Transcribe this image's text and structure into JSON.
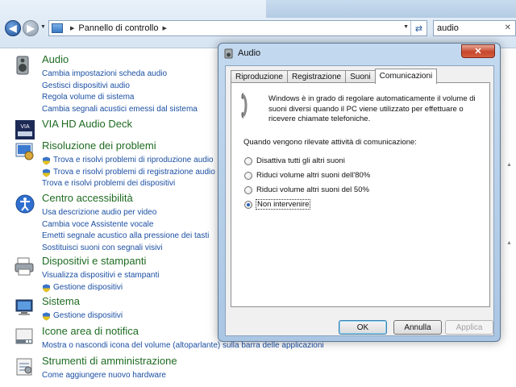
{
  "explorer": {
    "address_label": "Pannello di controllo",
    "search_value": "audio",
    "colors": {
      "category_title": "#1e6b21",
      "link": "#1b4fa3"
    }
  },
  "categories": [
    {
      "title": "Audio",
      "icon": "speaker-icon",
      "links": [
        {
          "label": "Cambia impostazioni scheda audio",
          "shield": false
        },
        {
          "label": "Gestisci dispositivi audio",
          "shield": false
        },
        {
          "label": "Regola volume di sistema",
          "shield": false
        },
        {
          "label": "Cambia segnali acustici emessi dal sistema",
          "shield": false
        }
      ]
    },
    {
      "title": "VIA HD Audio Deck",
      "icon": "via-deck-icon",
      "links": []
    },
    {
      "title": "Risoluzione dei problemi",
      "icon": "troubleshoot-icon",
      "links": [
        {
          "label": "Trova e risolvi problemi di riproduzione audio",
          "shield": true
        },
        {
          "label": "Trova e risolvi problemi di registrazione audio",
          "shield": true
        },
        {
          "label": "Trova e risolvi problemi dei dispositivi",
          "shield": false
        }
      ]
    },
    {
      "title": "Centro accessibilità",
      "icon": "accessibility-icon",
      "links": [
        {
          "label": "Usa descrizione audio per video",
          "shield": false
        },
        {
          "label": "Cambia voce Assistente vocale",
          "shield": false
        },
        {
          "label": "Emetti segnale acustico alla pressione dei tasti",
          "shield": false
        },
        {
          "label": "Sostituisci suoni con segnali visivi",
          "shield": false
        }
      ]
    },
    {
      "title": "Dispositivi e stampanti",
      "icon": "printer-icon",
      "links": [
        {
          "label": "Visualizza dispositivi e stampanti",
          "shield": false
        },
        {
          "label": "Gestione dispositivi",
          "shield": true
        }
      ]
    },
    {
      "title": "Sistema",
      "icon": "computer-icon",
      "links": [
        {
          "label": "Gestione dispositivi",
          "shield": true
        }
      ]
    },
    {
      "title": "Icone area di notifica",
      "icon": "notification-area-icon",
      "links": [
        {
          "label": "Mostra o nascondi icona del volume (altoparlante) sulla barra delle applicazioni",
          "shield": false
        }
      ]
    },
    {
      "title": "Strumenti di amministrazione",
      "icon": "admin-tools-icon",
      "links": [
        {
          "label": "Come aggiungere nuovo hardware",
          "shield": false
        }
      ]
    }
  ],
  "dialog": {
    "title": "Audio",
    "close_label": "✕",
    "tabs": [
      "Riproduzione",
      "Registrazione",
      "Suoni",
      "Comunicazioni"
    ],
    "active_tab": "Comunicazioni",
    "description": "Windows è in grado di regolare automaticamente il volume di suoni diversi quando il PC viene utilizzato per effettuare o ricevere chiamate telefoniche.",
    "question": "Quando vengono rilevate attività di comunicazione:",
    "options": [
      {
        "label": "Disattiva tutti gli altri suoni",
        "checked": false
      },
      {
        "label": "Riduci volume altri suoni dell'80%",
        "checked": false
      },
      {
        "label": "Riduci volume altri suoni del 50%",
        "checked": false
      },
      {
        "label": "Non intervenire",
        "checked": true
      }
    ],
    "buttons": {
      "ok": "OK",
      "cancel": "Annulla",
      "apply": "Applica"
    }
  }
}
